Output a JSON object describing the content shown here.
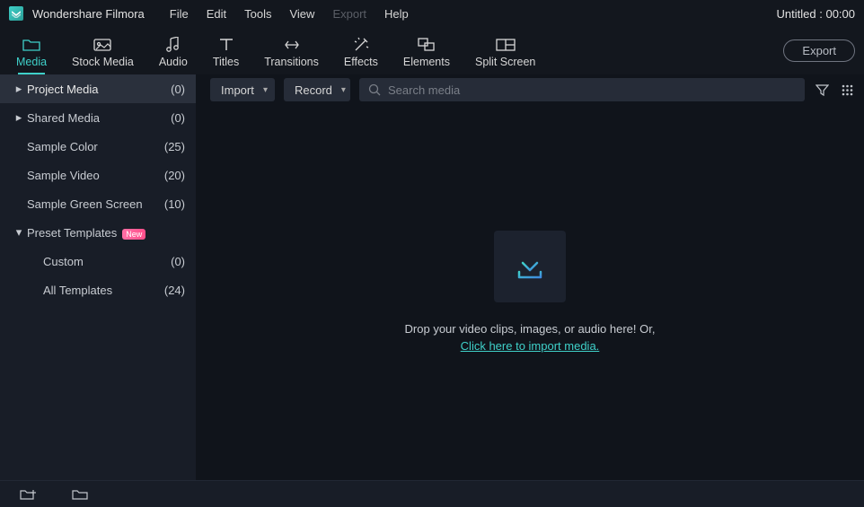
{
  "titlebar": {
    "app_name": "Wondershare Filmora",
    "menus": [
      "File",
      "Edit",
      "Tools",
      "View",
      "Export",
      "Help"
    ],
    "disabled_menu": "Export",
    "project_title": "Untitled : 00:00"
  },
  "toolbar": {
    "tabs": [
      {
        "label": "Media",
        "active": true
      },
      {
        "label": "Stock Media",
        "active": false
      },
      {
        "label": "Audio",
        "active": false
      },
      {
        "label": "Titles",
        "active": false
      },
      {
        "label": "Transitions",
        "active": false
      },
      {
        "label": "Effects",
        "active": false
      },
      {
        "label": "Elements",
        "active": false
      },
      {
        "label": "Split Screen",
        "active": false
      }
    ],
    "export_label": "Export"
  },
  "sidebar": {
    "items": [
      {
        "label": "Project Media",
        "count": "(0)",
        "caret": "right",
        "selected": true,
        "child": false
      },
      {
        "label": "Shared Media",
        "count": "(0)",
        "caret": "right",
        "selected": false,
        "child": false
      },
      {
        "label": "Sample Color",
        "count": "(25)",
        "caret": "none",
        "selected": false,
        "child": false
      },
      {
        "label": "Sample Video",
        "count": "(20)",
        "caret": "none",
        "selected": false,
        "child": false
      },
      {
        "label": "Sample Green Screen",
        "count": "(10)",
        "caret": "none",
        "selected": false,
        "child": false
      },
      {
        "label": "Preset Templates",
        "count": "",
        "caret": "down",
        "selected": false,
        "child": false,
        "badge": "New"
      },
      {
        "label": "Custom",
        "count": "(0)",
        "caret": "none",
        "selected": false,
        "child": true
      },
      {
        "label": "All Templates",
        "count": "(24)",
        "caret": "none",
        "selected": false,
        "child": true
      }
    ]
  },
  "content_toolbar": {
    "import_label": "Import",
    "record_label": "Record",
    "search_placeholder": "Search media"
  },
  "drop_area": {
    "line1": "Drop your video clips, images, or audio here! Or,",
    "link": "Click here to import media."
  }
}
